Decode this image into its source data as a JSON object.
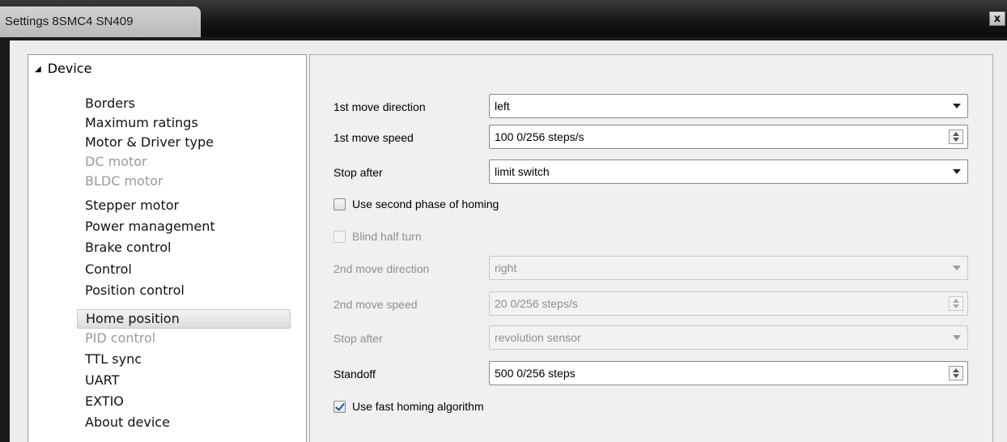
{
  "window": {
    "title": "Settings 8SMC4 SN409",
    "close_label": "x"
  },
  "tree": {
    "root_label": "Device",
    "items": [
      {
        "label": "Borders",
        "disabled": false
      },
      {
        "label": "Maximum ratings",
        "disabled": false
      },
      {
        "label": "Motor & Driver type",
        "disabled": false
      },
      {
        "label": "DC motor",
        "disabled": true
      },
      {
        "label": "BLDC motor",
        "disabled": true
      },
      {
        "label": "Stepper motor",
        "disabled": false
      },
      {
        "label": "Power management",
        "disabled": false
      },
      {
        "label": "Brake control",
        "disabled": false
      },
      {
        "label": "Control",
        "disabled": false
      },
      {
        "label": "Position control",
        "disabled": false
      },
      {
        "label": "Home position",
        "disabled": false,
        "selected": true
      },
      {
        "label": "PID control",
        "disabled": true
      },
      {
        "label": "TTL sync",
        "disabled": false
      },
      {
        "label": "UART",
        "disabled": false
      },
      {
        "label": "EXTIO",
        "disabled": false
      },
      {
        "label": "About device",
        "disabled": false
      }
    ]
  },
  "form": {
    "first_dir": {
      "label": "1st move direction",
      "value": "left"
    },
    "first_speed": {
      "label": "1st move speed",
      "value": "100 0/256 steps/s"
    },
    "stop_after_1": {
      "label": "Stop after",
      "value": "limit switch"
    },
    "second_phase": {
      "label": "Use second phase of homing",
      "checked": false
    },
    "blind_half": {
      "label": "Blind half turn",
      "checked": false
    },
    "second_dir": {
      "label": "2nd move direction",
      "value": "right"
    },
    "second_speed": {
      "label": "2nd move speed",
      "value": "20 0/256 steps/s"
    },
    "stop_after_2": {
      "label": "Stop after",
      "value": "revolution sensor"
    },
    "standoff": {
      "label": "Standoff",
      "value": "500 0/256 steps"
    },
    "fast_homing": {
      "label": "Use fast homing algorithm",
      "checked": true
    }
  }
}
